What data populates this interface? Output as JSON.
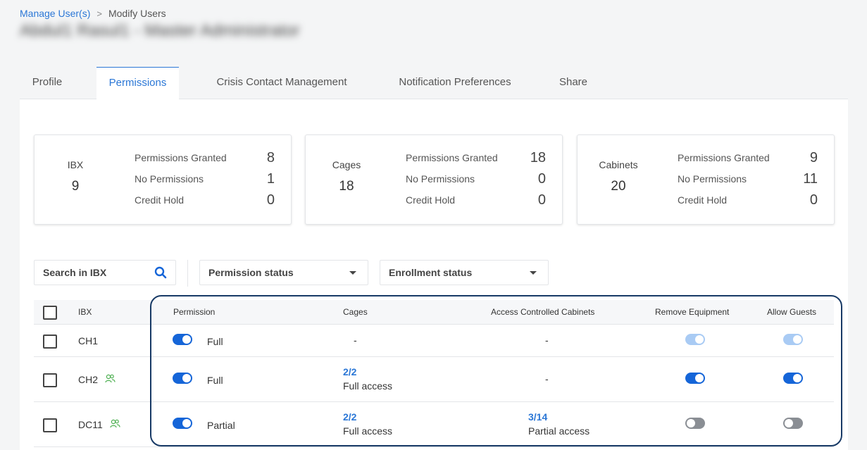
{
  "breadcrumb": {
    "parent": "Manage User(s)",
    "separator": ">",
    "current": "Modify Users"
  },
  "page_title": "Abdul1 Rasul1 - Master Administrator",
  "tabs": [
    {
      "label": "Profile",
      "active": false
    },
    {
      "label": "Permissions",
      "active": true
    },
    {
      "label": "Crisis Contact Management",
      "active": false
    },
    {
      "label": "Notification Preferences",
      "active": false
    },
    {
      "label": "Share",
      "active": false
    }
  ],
  "summary_cards": [
    {
      "category": "IBX",
      "count": "9",
      "granted_label": "Permissions Granted",
      "granted": "8",
      "none_label": "No Permissions",
      "none": "1",
      "hold_label": "Credit Hold",
      "hold": "0"
    },
    {
      "category": "Cages",
      "count": "18",
      "granted_label": "Permissions Granted",
      "granted": "18",
      "none_label": "No Permissions",
      "none": "0",
      "hold_label": "Credit Hold",
      "hold": "0"
    },
    {
      "category": "Cabinets",
      "count": "20",
      "granted_label": "Permissions Granted",
      "granted": "9",
      "none_label": "No Permissions",
      "none": "11",
      "hold_label": "Credit Hold",
      "hold": "0"
    }
  ],
  "filters": {
    "search_placeholder": "Search in IBX",
    "permission_status": "Permission status",
    "enrollment_status": "Enrollment status"
  },
  "table": {
    "columns": {
      "ibx": "IBX",
      "permission": "Permission",
      "cages": "Cages",
      "cabinets": "Access Controlled Cabinets",
      "remove_equipment": "Remove Equipment",
      "allow_guests": "Allow Guests"
    },
    "rows": [
      {
        "ibx": "CH1",
        "guest_icon": false,
        "permission_label": "Full",
        "permission_state": "on",
        "cages_value": "",
        "cages_text": "-",
        "cabinets_value": "",
        "cabinets_text": "-",
        "remove_equipment_state": "disabled",
        "allow_guests_state": "disabled"
      },
      {
        "ibx": "CH2",
        "guest_icon": true,
        "permission_label": "Full",
        "permission_state": "on",
        "cages_value": "2/2",
        "cages_text": "Full access",
        "cabinets_value": "",
        "cabinets_text": "-",
        "remove_equipment_state": "on",
        "allow_guests_state": "on"
      },
      {
        "ibx": "DC11",
        "guest_icon": true,
        "permission_label": "Partial",
        "permission_state": "on",
        "cages_value": "2/2",
        "cages_text": "Full access",
        "cabinets_value": "3/14",
        "cabinets_text": "Partial access",
        "remove_equipment_state": "off",
        "allow_guests_state": "off"
      }
    ]
  },
  "colors": {
    "accent": "#2b77d6",
    "toggle_on": "#1565d8",
    "toggle_off": "#8a8e94",
    "toggle_disabled": "#a9cbf4",
    "highlight_border": "#183a66",
    "guest_icon": "#4caf50"
  }
}
